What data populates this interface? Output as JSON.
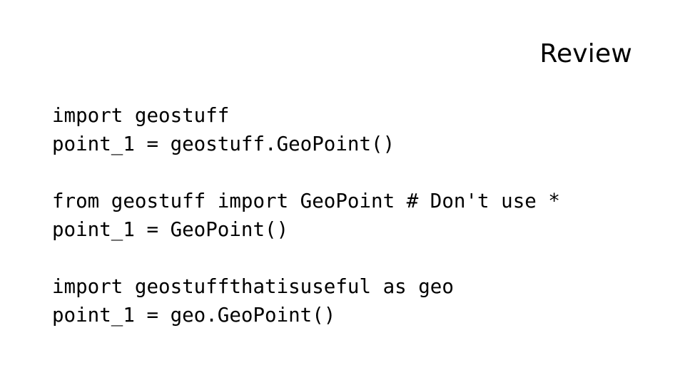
{
  "slide": {
    "title": "Review",
    "background_color": "#ffffff",
    "text_color": "#000000",
    "code_groups": [
      {
        "lines": [
          "import geostuff",
          "point_1 = geostuff.GeoPoint()"
        ]
      },
      {
        "lines": [
          "from geostuff import GeoPoint # Don't use *",
          "point_1 = GeoPoint()"
        ]
      },
      {
        "lines": [
          "import geostuffthatisuseful as geo",
          "point_1 = geo.GeoPoint()"
        ]
      }
    ]
  }
}
